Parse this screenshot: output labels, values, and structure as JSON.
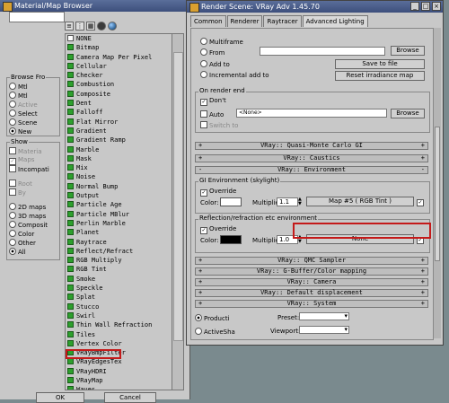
{
  "mmb": {
    "title": "Material/Map Browser",
    "browse_from": {
      "label": "Browse Fro",
      "options": [
        {
          "label": "Mtl",
          "selected": false,
          "disabled": false
        },
        {
          "label": "Mtl",
          "selected": false,
          "disabled": false
        },
        {
          "label": "Active",
          "selected": false,
          "disabled": true
        },
        {
          "label": "Select",
          "selected": false,
          "disabled": false
        },
        {
          "label": "Scene",
          "selected": false,
          "disabled": false
        },
        {
          "label": "New",
          "selected": true,
          "disabled": false
        }
      ]
    },
    "show": {
      "label": "Show",
      "checks": [
        {
          "label": "Materia",
          "checked": false,
          "disabled": true
        },
        {
          "label": "Maps",
          "checked": true,
          "disabled": true
        },
        {
          "label": "Incompati",
          "checked": false,
          "disabled": false
        }
      ],
      "extra": [
        {
          "label": "Root",
          "disabled": true
        },
        {
          "label": "By",
          "disabled": true
        }
      ],
      "radios": [
        {
          "label": "2D maps",
          "selected": false
        },
        {
          "label": "3D maps",
          "selected": false
        },
        {
          "label": "Composit",
          "selected": false
        },
        {
          "label": "Color",
          "selected": false
        },
        {
          "label": "Other",
          "selected": false
        },
        {
          "label": "All",
          "selected": true
        }
      ]
    },
    "list": [
      {
        "label": "NONE",
        "icon": "white"
      },
      {
        "label": "Bitmap",
        "icon": "green"
      },
      {
        "label": "Camera Map Per Pixel",
        "icon": "green"
      },
      {
        "label": "Cellular",
        "icon": "green"
      },
      {
        "label": "Checker",
        "icon": "green"
      },
      {
        "label": "Combustion",
        "icon": "green"
      },
      {
        "label": "Composite",
        "icon": "green"
      },
      {
        "label": "Dent",
        "icon": "green"
      },
      {
        "label": "Falloff",
        "icon": "green"
      },
      {
        "label": "Flat Mirror",
        "icon": "green"
      },
      {
        "label": "Gradient",
        "icon": "green"
      },
      {
        "label": "Gradient Ramp",
        "icon": "green"
      },
      {
        "label": "Marble",
        "icon": "green"
      },
      {
        "label": "Mask",
        "icon": "green"
      },
      {
        "label": "Mix",
        "icon": "green"
      },
      {
        "label": "Noise",
        "icon": "green"
      },
      {
        "label": "Normal Bump",
        "icon": "green"
      },
      {
        "label": "Output",
        "icon": "green"
      },
      {
        "label": "Particle Age",
        "icon": "green"
      },
      {
        "label": "Particle MBlur",
        "icon": "green"
      },
      {
        "label": "Perlin Marble",
        "icon": "green"
      },
      {
        "label": "Planet",
        "icon": "green"
      },
      {
        "label": "Raytrace",
        "icon": "green"
      },
      {
        "label": "Reflect/Refract",
        "icon": "green"
      },
      {
        "label": "RGB Multiply",
        "icon": "green"
      },
      {
        "label": "RGB Tint",
        "icon": "green"
      },
      {
        "label": "Smoke",
        "icon": "green"
      },
      {
        "label": "Speckle",
        "icon": "green"
      },
      {
        "label": "Splat",
        "icon": "green"
      },
      {
        "label": "Stucco",
        "icon": "green"
      },
      {
        "label": "Swirl",
        "icon": "green"
      },
      {
        "label": "Thin Wall Refraction",
        "icon": "green"
      },
      {
        "label": "Tiles",
        "icon": "green"
      },
      {
        "label": "Vertex Color",
        "icon": "green"
      },
      {
        "label": "VRayBmpFilter",
        "icon": "green"
      },
      {
        "label": "VRayEdgesTex",
        "icon": "green"
      },
      {
        "label": "VRayHDRI",
        "icon": "green"
      },
      {
        "label": "VRayMap",
        "icon": "green"
      },
      {
        "label": "Waves",
        "icon": "green"
      },
      {
        "label": "Wood",
        "icon": "green"
      }
    ],
    "ok_label": "OK",
    "cancel_label": "Cancel"
  },
  "rs": {
    "title": "Render Scene: VRay Adv 1.45.70",
    "tabs": [
      "Common",
      "Renderer",
      "Raytracer",
      "Advanced Lighting"
    ],
    "multiframe": "Multiframe",
    "from_label": "From",
    "browse": "Browse",
    "add_to": "Add to",
    "save_to_file": "Save to file",
    "incremental": "Incremental add to",
    "reset_irr": "Reset irradiance map",
    "on_render_end": "On render end",
    "dont": "Don't",
    "auto": "Auto",
    "none_tag": "<None>",
    "switch_to": "Switch to",
    "rollouts_top": [
      "VRay:: Quasi-Monte Carlo GI",
      "VRay:: Caustics",
      "VRay:: Environment"
    ],
    "gi_env_label": "GI Environment (skylight)",
    "override": "Override",
    "color_label": "Color:",
    "multiplier_label": "Multiplier:",
    "gi_mult": "1.1",
    "gi_map": "Map #5  ( RGB Tint )",
    "refl_label": "Reflection/refraction etc environment",
    "refl_mult": "1.0",
    "refl_map": "None",
    "rollouts_bottom": [
      "VRay:: QMC Sampler",
      "VRay:: G-Buffer/Color mapping",
      "VRay:: Camera",
      "VRay:: Default displacement",
      "VRay:: System"
    ],
    "production": "Producti",
    "activeshade": "ActiveSha",
    "preset": "Preset:",
    "viewport": "Viewport:"
  }
}
